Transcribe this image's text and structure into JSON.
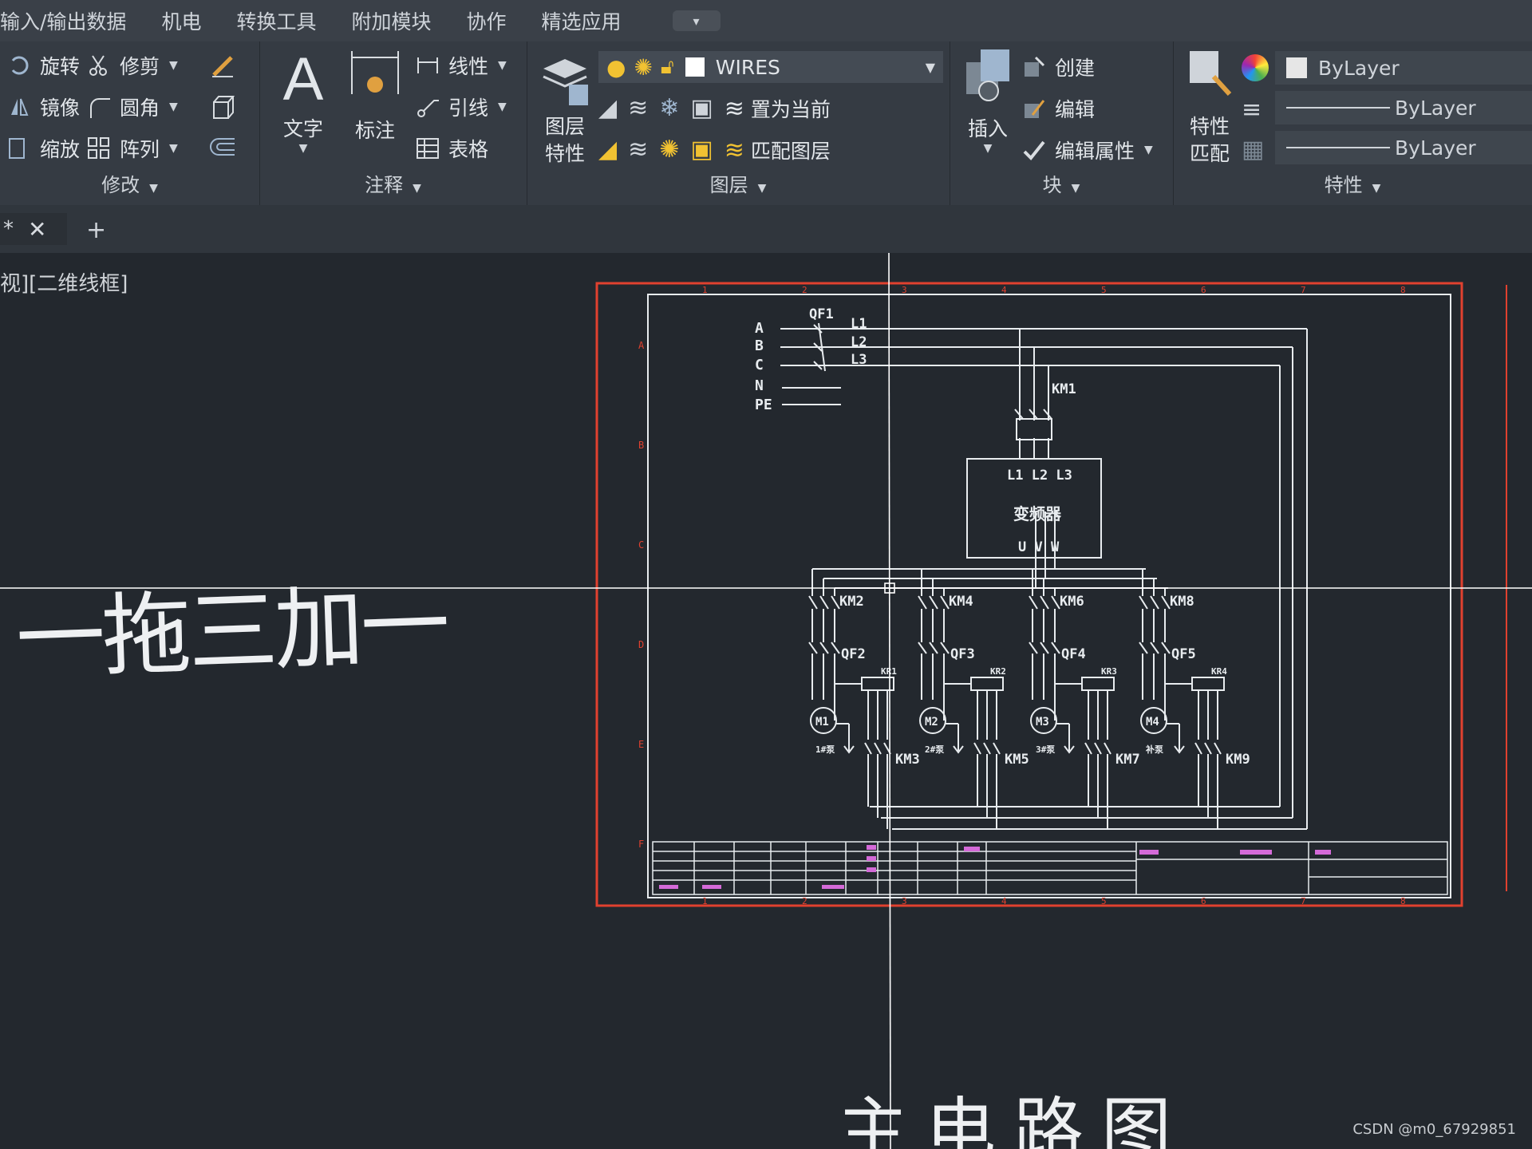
{
  "menu": {
    "items": [
      "输入/输出数据",
      "机电",
      "转换工具",
      "附加模块",
      "协作",
      "精选应用"
    ],
    "dropdown": "▾"
  },
  "ribbon": {
    "modify": {
      "title": "修改",
      "rotate": "旋转",
      "trim": "修剪",
      "mirror": "镜像",
      "fillet": "圆角",
      "scale": "缩放",
      "array": "阵列"
    },
    "annotation": {
      "title": "注释",
      "text": "文字",
      "dimension": "标注",
      "linear": "线性",
      "leader": "引线",
      "table": "表格"
    },
    "layers": {
      "title": "图层",
      "properties": "图层\n特性",
      "current_layer": "WIRES",
      "set_current": "置为当前",
      "match_layer": "匹配图层"
    },
    "block": {
      "title": "块",
      "insert": "插入",
      "create": "创建",
      "edit": "编辑",
      "edit_attr": "编辑属性"
    },
    "properties": {
      "title": "特性",
      "match": "特性\n匹配",
      "color": "ByLayer",
      "linetype": "ByLayer",
      "lineweight": "ByLayer"
    }
  },
  "tabs": {
    "active_suffix": "*"
  },
  "canvas": {
    "view_label": "视][二维线框]",
    "handwritten_title": "一拖三加一",
    "bottom_text": "主电路图",
    "watermark": "CSDN @m0_67929851"
  },
  "schematic": {
    "phases": [
      "A",
      "B",
      "C",
      "N",
      "PE"
    ],
    "phase_labels": [
      "L1",
      "L2",
      "L3"
    ],
    "breaker_main": "QF1",
    "contactor_main": "KM1",
    "vfd_label": "变频器",
    "vfd_inputs": "L1 L2 L3",
    "vfd_outputs": "U V W",
    "branch_contactors": [
      "KM2",
      "KM4",
      "KM6",
      "KM8"
    ],
    "branch_breakers": [
      "QF2",
      "QF3",
      "QF4",
      "QF5"
    ],
    "relays": [
      "KR1",
      "KR2",
      "KR3",
      "KR4"
    ],
    "motors": [
      "M1",
      "M2",
      "M3",
      "M4"
    ],
    "pump_labels": [
      "1#泵",
      "2#泵",
      "3#泵",
      "补泵"
    ],
    "bypass_contactors": [
      "KM3",
      "KM5",
      "KM7",
      "KM9"
    ],
    "row_letters": [
      "A",
      "B",
      "C",
      "D",
      "E",
      "F"
    ],
    "col_numbers": [
      "1",
      "2",
      "3",
      "4",
      "5",
      "6",
      "7",
      "8"
    ]
  },
  "colors": {
    "border_red": "#e0412f",
    "line_white": "#e8ecef",
    "title_magenta": "#d46ad8"
  }
}
